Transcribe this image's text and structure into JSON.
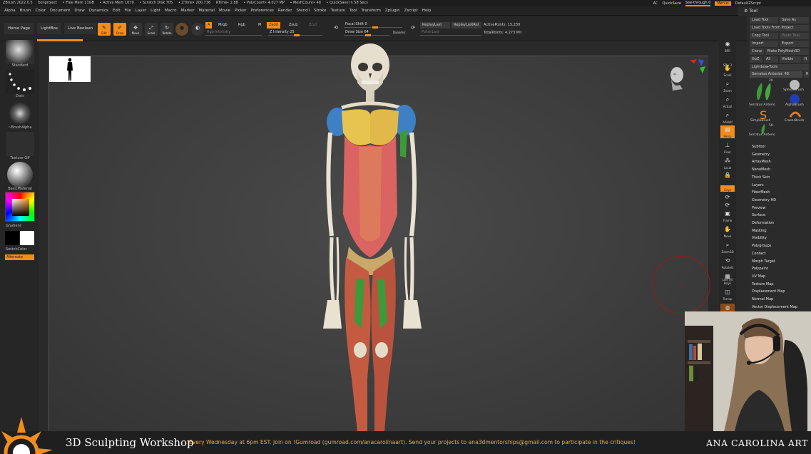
{
  "titlebar": {
    "items": [
      "ZBrush 2022.0.5",
      "bonproject",
      "• Free Mem 11GB",
      "• Active Mem 1079",
      "• Scratch Disk 705",
      "• ZTime• 200.736",
      "RTime• 2.88",
      "• PolyCount• 4.027 MP",
      "• MeshCount• 48",
      "• QuickSave In 58 Secs"
    ],
    "ac": "AC",
    "quicksave": "QuickSave",
    "seethrough": "See-through 0",
    "menus": "Menus",
    "default_script": "DefaultZScript"
  },
  "menubar": [
    "Alpha",
    "Brush",
    "Color",
    "Document",
    "Draw",
    "Dynamics",
    "Edit",
    "File",
    "Layer",
    "Light",
    "Macro",
    "Marker",
    "Material",
    "Movie",
    "Picker",
    "Preferences",
    "Render",
    "Stencil",
    "Stroke",
    "Texture",
    "Tool",
    "Transform",
    "Zplugin",
    "Zscript",
    "Help"
  ],
  "nav": {
    "home": "Home Page",
    "lightbox": "LightBox",
    "live_boolean": "Live Boolean"
  },
  "shelf": {
    "edit": "Edit",
    "draw": "Draw",
    "move": "Move",
    "scale": "Scale",
    "rotate": "Rotate",
    "a": "A",
    "mrgb": "Mrgb",
    "rgb": "Rgb",
    "m": "M",
    "zadd": "Zadd",
    "zsub": "Zsub",
    "zcut": "Zcut",
    "rgb_intensity": "Rgb Intensity",
    "z_intensity": "Z Intensity 25",
    "focal_shift": "Focal Shift 0",
    "draw_size": "Draw Size 64",
    "dynamic": "Dynamic",
    "replay_last": "ReplayLast",
    "replay_last_rel": "ReplayLastRel",
    "polish_last": "PolishLast",
    "active_points": "ActivePoints: 15,230",
    "total_points": "TotalPoints: 4.273 Mil"
  },
  "leftpanel": {
    "standard": "Standard",
    "dots": "Dots",
    "brush_alpha": "~BrushAlpha",
    "texture_off": "Texture Off",
    "basic_material": "BasicMaterial",
    "gradient": "Gradient",
    "switch_color": "SwitchColor",
    "alternate": "Alternate"
  },
  "right_icons": [
    "BPR",
    "SPix 3",
    "Scroll",
    "Zoom",
    "Actual",
    "AAHalf",
    "Persp",
    "Floor",
    "Local",
    "Gxyz",
    "Frame",
    "Move",
    "Zoom3D",
    "RotateG",
    "Line Fill PolyF",
    "Transp",
    "Ghost",
    "Solo"
  ],
  "tool": {
    "header": "Tool",
    "load_tool": "Load Tool",
    "save_as": "Save As",
    "load_from_project": "Load Tools From Project",
    "copy_tool": "Copy Tool",
    "paste_tool": "Paste Tool",
    "import": "Import",
    "export": "Export",
    "clone": "Clone",
    "make_polymesh": "Make PolyMesh3D",
    "goz": "GoZ",
    "all": "All",
    "visible": "Visible",
    "r": "R",
    "lightbox_tools": "Lightbox▸Tools",
    "current": "Serratus Anterior. 48",
    "current_r": "R",
    "thumb_count": "20",
    "thumb_count2": "50",
    "thumbs": [
      "Serratus Anterio",
      "SphereBrush",
      "AlphaBrush",
      "SimpleBrush",
      "EraserBrush",
      "Serratus Anterio"
    ],
    "subpalettes": [
      "Subtool",
      "Geometry",
      "ArrayMesh",
      "NanoMesh",
      "Thick Skin",
      "Layers",
      "FiberMesh",
      "Geometry HD",
      "Preview",
      "Surface",
      "Deformation",
      "Masking",
      "Visibility",
      "Polygroups",
      "Contact",
      "Morph Target",
      "Polypaint",
      "UV Map",
      "Texture Map",
      "Displacement Map",
      "Normal Map",
      "Vector Displacement Map"
    ]
  },
  "banner": {
    "title": "3D Sculpting Workshop",
    "text": "Every Wednesday at 6pm EST. Join on !Gumroad (gumroad.com/anacarolinaart). Send your projects to ana3dmentorships@gmail.com to participate in the critiques!",
    "brand": "ANA CAROLINA ART"
  },
  "colors": {
    "accent": "#f28d1c",
    "banner_text": "#f4a43a",
    "bg": "#2a2a2a"
  }
}
